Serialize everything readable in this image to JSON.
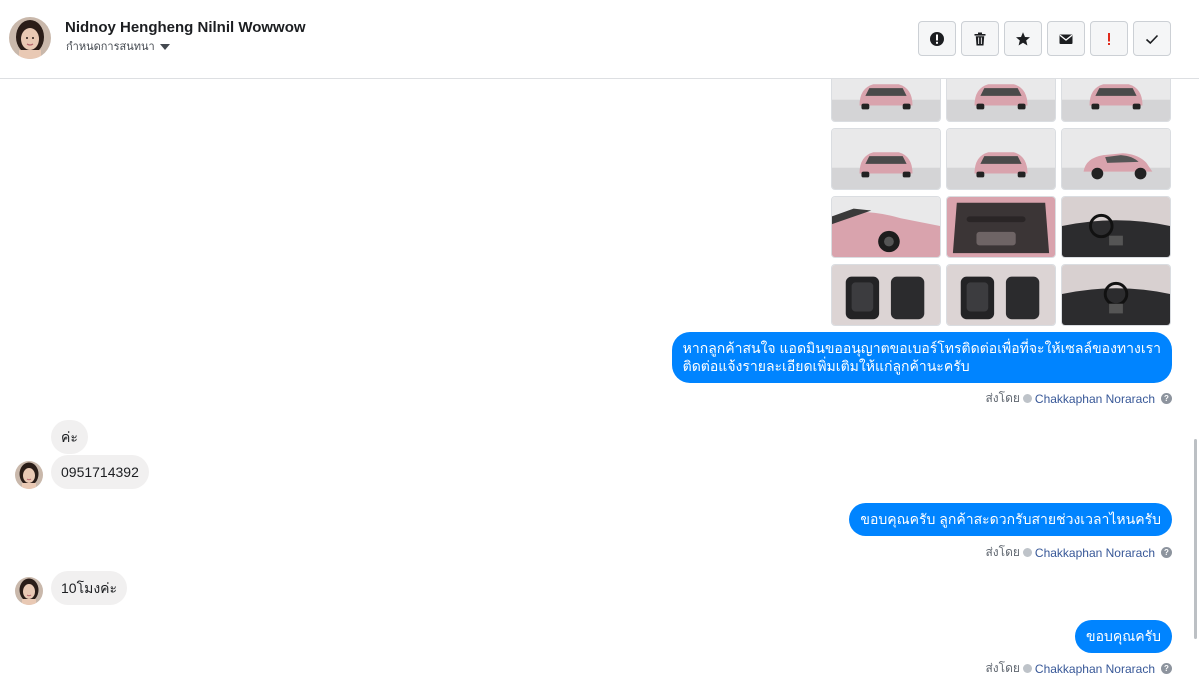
{
  "header": {
    "contact_name": "Nidnoy Hengheng Nilnil Wowwow",
    "assign_label": "กำหนดการสนทนา",
    "actions": [
      {
        "name": "report-spam-button",
        "icon": "alert-circle-icon"
      },
      {
        "name": "delete-button",
        "icon": "trash-icon"
      },
      {
        "name": "star-button",
        "icon": "star-icon"
      },
      {
        "name": "mark-unread-button",
        "icon": "envelope-icon"
      },
      {
        "name": "follow-up-button",
        "icon": "exclamation-icon"
      },
      {
        "name": "mark-done-button",
        "icon": "check-icon"
      }
    ]
  },
  "messages": {
    "out_1": "หากลูกค้าสนใจ แอดมินขออนุญาตขอเบอร์โทรติดต่อเพื่อที่จะให้เซลล์ของทางเรา\nติดต่อแจ้งรายละเอียดเพิ่มเติมให้แก่ลูกค้านะครับ",
    "in_1": "ค่ะ",
    "in_2": "0951714392",
    "out_2": "ขอบคุณครับ ลูกค้าสะดวกรับสายช่วงเวลาไหนครับ",
    "in_3": "10โมงค่ะ",
    "out_3": "ขอบคุณครับ"
  },
  "sent_by": {
    "prefix": "ส่งโดย",
    "agent_name": "Chakkaphan Norarach"
  },
  "colors": {
    "outgoing_bubble": "#0084ff",
    "incoming_bubble": "#f1f0f0",
    "link": "#385898",
    "car_pink": "#d9a3ad"
  },
  "photos": [
    {
      "view": "front"
    },
    {
      "view": "front-3q"
    },
    {
      "view": "rear-3q"
    },
    {
      "view": "rear"
    },
    {
      "view": "front-3q"
    },
    {
      "view": "side"
    },
    {
      "view": "front-detail"
    },
    {
      "view": "door-interior"
    },
    {
      "view": "dashboard"
    },
    {
      "view": "front-seats"
    },
    {
      "view": "rear-seats"
    },
    {
      "view": "console"
    }
  ]
}
